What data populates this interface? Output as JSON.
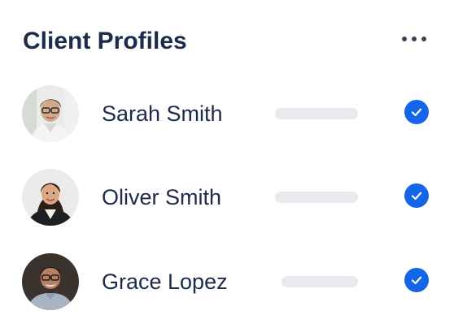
{
  "card": {
    "title": "Client Profiles",
    "menu_icon": "more-horizontal-icon"
  },
  "clients": [
    {
      "name": "Sarah Smith",
      "avatar": "avatar-photo",
      "status_icon": "check-circle-icon",
      "verified": true
    },
    {
      "name": "Oliver Smith",
      "avatar": "avatar-photo",
      "status_icon": "check-circle-icon",
      "verified": true
    },
    {
      "name": "Grace Lopez",
      "avatar": "avatar-photo",
      "status_icon": "check-circle-icon",
      "verified": true
    }
  ],
  "colors": {
    "title": "#1c2b4a",
    "name": "#1c2b4a",
    "check": "#1565e8",
    "placeholder": "#e8eaee",
    "menu_dots": "#3a4355"
  }
}
